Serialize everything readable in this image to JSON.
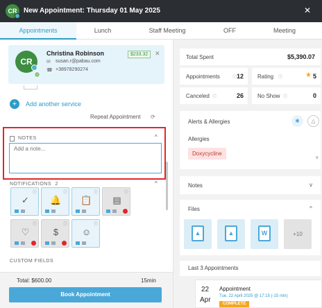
{
  "window": {
    "title": "New Appointment: Thursday 01 May 2025",
    "avatar_initials": "CR",
    "close_glyph": "✕"
  },
  "tabs": [
    "Appointments",
    "Lunch",
    "Staff Meeting",
    "OFF",
    "Meeting"
  ],
  "client": {
    "initials": "CR",
    "name": "Christina Robinson",
    "email": "susan.r@pabau.com",
    "phone": "+38978290274",
    "balance": "$233.32",
    "remove_glyph": "✕"
  },
  "services": {
    "add_label": "Add another service",
    "repeat_label": "Repeat Appointment"
  },
  "notes": {
    "label": "NOTES",
    "placeholder": "Add a note..."
  },
  "notifications": {
    "label": "NOTIFICATIONS",
    "count": "2",
    "tiles": [
      {
        "icon": "check-circle-icon",
        "glyph": "✓",
        "enabled": true,
        "warning": false
      },
      {
        "icon": "bell-icon",
        "glyph": "🔔",
        "enabled": true,
        "warning": false
      },
      {
        "icon": "clipboard-icon",
        "glyph": "📋",
        "enabled": true,
        "warning": false
      },
      {
        "icon": "form-icon",
        "glyph": "▤",
        "enabled": false,
        "warning": true
      },
      {
        "icon": "hand-heart-icon",
        "glyph": "♡",
        "enabled": false,
        "warning": true
      },
      {
        "icon": "money-icon",
        "glyph": "$",
        "enabled": false,
        "warning": true
      },
      {
        "icon": "smile-icon",
        "glyph": "☺",
        "enabled": true,
        "warning": false
      }
    ]
  },
  "custom_fields": {
    "label": "CUSTOM FIELDS"
  },
  "footer": {
    "total": "Total: $600.00",
    "duration": "15min",
    "book_label": "Book Appointment"
  },
  "stats": {
    "total_spent_label": "Total Spent",
    "total_spent_value": "$5,390.07",
    "appointments_label": "Appointments",
    "appointments_value": "12",
    "rating_label": "Rating",
    "rating_value": "5",
    "canceled_label": "Canceled",
    "canceled_value": "26",
    "noshow_label": "No Show",
    "noshow_value": "0"
  },
  "alerts": {
    "title": "Alerts & Allergies",
    "allergies_label": "Allergies",
    "allergy": "Doxycycline"
  },
  "notes_section": {
    "title": "Notes"
  },
  "files": {
    "title": "Files",
    "items": [
      "image-file-icon",
      "image-file-icon",
      "word-file-icon"
    ],
    "more": "+10"
  },
  "last_appointments": {
    "title": "Last 3 Appointments",
    "items": [
      {
        "day": "22",
        "month": "Apr",
        "title": "Appointment",
        "datetime": "Tue, 22 April 2025 @ 17:15 (-15 min)",
        "status": "COMPLETE"
      }
    ]
  },
  "colors": {
    "accent": "#2d9cc9",
    "header_bg": "#2b2f33",
    "highlight": "#e0262b",
    "complete": "#f5a623"
  }
}
